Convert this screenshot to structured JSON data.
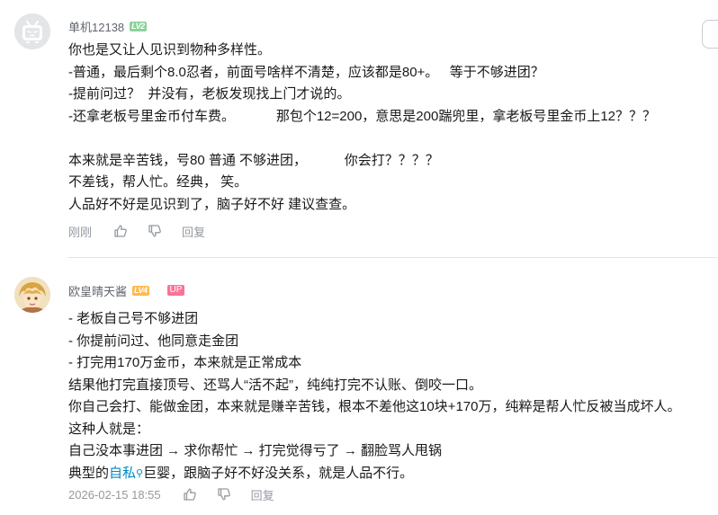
{
  "comments": [
    {
      "username": "单机12138",
      "level": "LV2",
      "avatar": "tv-avatar-icon",
      "lines": [
        "你也是又让人见识到物种多样性。",
        "-普通，最后剩个8.0忍者，前面号啥样不清楚，应该都是80+。   等于不够进团？",
        "-提前问过？  并没有，老板发现找上门才说的。",
        "-还拿老板号里金币付车费。           那包个12=200，意思是200踹兜里，拿老板号里金币上12？？？",
        "",
        "本来就是辛苦钱，号80 普通 不够进团，          你会打？？？？",
        "不差钱，帮人忙。经典， 笑。",
        "人品好不好是见识到了，脑子好不好 建议查查。"
      ],
      "time": "刚刚",
      "reply_label": "回复"
    },
    {
      "username": "欧皇晴天酱",
      "level": "LV4",
      "badge": "UP",
      "avatar": "anime-avatar-icon",
      "lines": [
        "- 老板自己号不够进团",
        "- 你提前问过、他同意走金团",
        "- 打完用170万金币，本来就是正常成本",
        "结果他打完直接顶号、还骂人“活不起”，纯纯打完不认账、倒咬一口。",
        "你自己会打、能做金团，本来就是赚辛苦钱，根本不差他这10块+170万，纯粹是帮人忙反被当成坏人。",
        "这种人就是：",
        "自己没本事进团 → 求你帮忙 → 打完觉得亏了 → 翻脸骂人甩锅"
      ],
      "last_line_pre": "典型的",
      "last_line_keyword": "自私",
      "last_line_post": "巨婴，跟脑子好不好没关系，就是人品不行。",
      "time": "2026-02-15 18:55",
      "reply_label": "回复"
    }
  ],
  "colors": {
    "level2": "#8bd29b",
    "level4": "#feb94d",
    "up_badge": "#fb7299",
    "keyword": "#008ac5",
    "meta": "#9499a0"
  }
}
